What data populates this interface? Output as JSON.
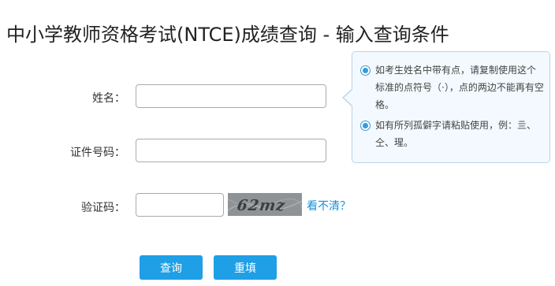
{
  "page": {
    "title": "中小学教师资格考试(NTCE)成绩查询 - 输入查询条件"
  },
  "form": {
    "name_label": "姓名：",
    "name_value": "",
    "id_label": "证件号码：",
    "id_value": "",
    "captcha_label": "验证码：",
    "captcha_value": "",
    "captcha_image_text": "62mz",
    "captcha_refresh_link": "看不清？"
  },
  "buttons": {
    "query": "查询",
    "reset": "重填"
  },
  "tips": [
    {
      "text": "如考生姓名中带有点，请复制使用这个标准的点符号（·），点的两边不能再有空格。"
    },
    {
      "text": "如有所列孤僻字请粘贴使用，例：亖、仝、瑆。"
    }
  ],
  "colors": {
    "accent": "#1e9fe6",
    "link": "#1a8fd8",
    "tip_background": "#f3f9fe",
    "tip_border": "#b9d4ea"
  }
}
